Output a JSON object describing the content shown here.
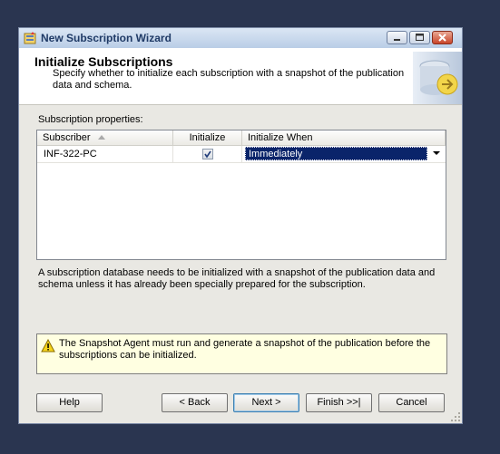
{
  "window": {
    "title": "New Subscription Wizard"
  },
  "header": {
    "title": "Initialize Subscriptions",
    "description": "Specify whether to initialize each subscription with a snapshot of the publication data and schema."
  },
  "grid": {
    "label": "Subscription properties:",
    "columns": [
      "Subscriber",
      "Initialize",
      "Initialize When"
    ],
    "rows": [
      {
        "subscriber": "INF-322-PC",
        "initialize": true,
        "initialize_when": "Immediately"
      }
    ]
  },
  "note": "A subscription database needs to be initialized with a snapshot of the publication data and schema unless it has already been specially prepared for the subscription.",
  "warning": "The Snapshot Agent must run and generate a snapshot of the publication before the subscriptions can be initialized.",
  "buttons": {
    "help": "Help",
    "back": "< Back",
    "next": "Next >",
    "finish": "Finish >>|",
    "cancel": "Cancel"
  }
}
